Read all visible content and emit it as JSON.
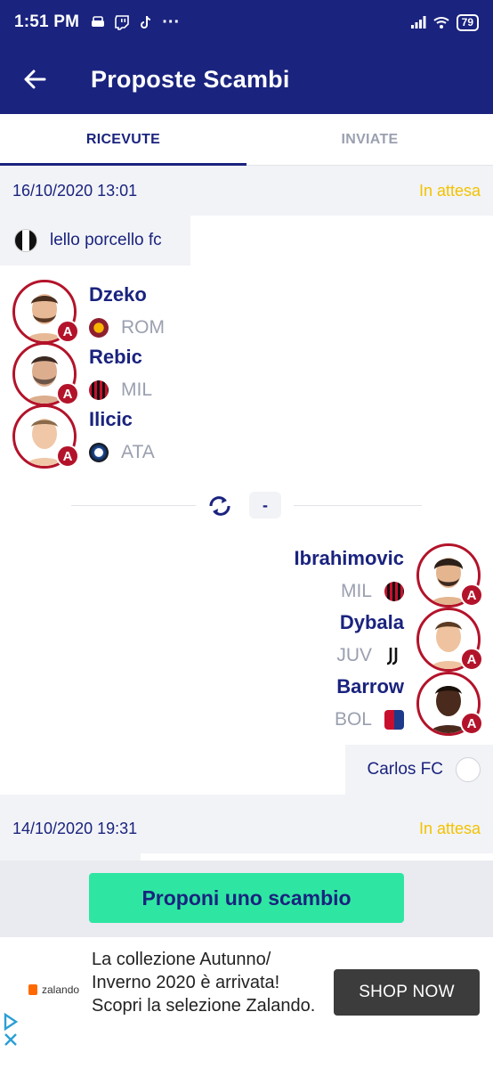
{
  "status_bar": {
    "time": "1:51 PM",
    "dots": "···",
    "battery": "79"
  },
  "app_bar": {
    "title": "Proposte Scambi"
  },
  "tabs": [
    {
      "label": "RICEVUTE",
      "active": true
    },
    {
      "label": "INVIATE",
      "active": false
    }
  ],
  "trades": [
    {
      "datetime": "16/10/2020 13:01",
      "status": "In attesa",
      "from_team": "lello porcello fc",
      "offered_players": [
        {
          "name": "Dzeko",
          "club": "ROM",
          "role": "A"
        },
        {
          "name": "Rebic",
          "club": "MIL",
          "role": "A"
        },
        {
          "name": "Ilicic",
          "club": "ATA",
          "role": "A"
        }
      ],
      "credits": "-",
      "requested_players": [
        {
          "name": "Ibrahimovic",
          "club": "MIL",
          "role": "A"
        },
        {
          "name": "Dybala",
          "club": "JUV",
          "role": "A"
        },
        {
          "name": "Barrow",
          "club": "BOL",
          "role": "A"
        }
      ],
      "to_team": "Carlos FC"
    },
    {
      "datetime": "14/10/2020 19:31",
      "status": "In attesa"
    }
  ],
  "cta": {
    "label": "Proponi uno scambio"
  },
  "ad": {
    "brand": "zalando",
    "text": "La collezione Autunno/ Inverno 2020 è arrivata! Scopri la selezione Zalando.",
    "button": "SHOP NOW"
  },
  "colors": {
    "primary": "#1a237e",
    "status_pending": "#f2c200",
    "role_badge": "#b3132a",
    "cta": "#2ee6a2"
  }
}
